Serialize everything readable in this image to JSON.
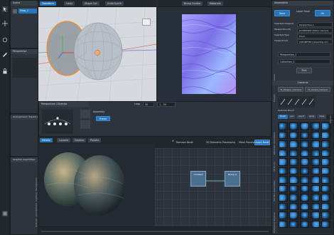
{
  "left_toolbar": {
    "icons": [
      "select-icon",
      "move-icon",
      "rotate-icon",
      "brush-icon",
      "lock-icon",
      "grid-icon"
    ]
  },
  "scene_panel": {
    "title": "Scene",
    "object_name": "Drop_1"
  },
  "perspective_panel": {
    "title": "Perspective"
  },
  "arrangement_panel": {
    "title": "Arrangement / Square Prism"
  },
  "assembly_panel": {
    "title": "Selected Assemblies",
    "tabs": [
      "Settings",
      "Architecture",
      "Lighting",
      "Background",
      "Arrange"
    ]
  },
  "viewport_toolbar": {
    "items": [
      "Transform",
      "Local",
      "Shape Cut",
      "Undo Synth"
    ]
  },
  "texture_toolbar": {
    "items": [
      "Bump Control",
      "Materials"
    ]
  },
  "timeline": {
    "title": "Perspective / Director",
    "field_label": "Assembly",
    "value": "Frame",
    "loop_label": "Loop",
    "loop_value": "30",
    "range_value": "1 - 30"
  },
  "bottom_tabs": [
    "Details",
    "Layouts",
    "Capture",
    "Presets"
  ],
  "node_toolbar": {
    "items": [
      "Remove Node",
      "2D Elements Processing",
      "Mask Processing"
    ],
    "apply_label": "Apply Node"
  },
  "nodes": [
    {
      "label": "Gradient"
    },
    {
      "label": "Bump A"
    }
  ],
  "right_panel": {
    "title": "Assemblies",
    "save_label": "Save",
    "layer_label": "Layer Save",
    "ok_label": "Ok",
    "props": [
      {
        "label": "Selected Viewport",
        "value": "Perspective_1"
      },
      {
        "label": "Perspective (Id)",
        "value": "[CONSTANT] Editor Camera"
      },
      {
        "label": "Selected Type",
        "value": "Fixed"
      },
      {
        "label": "Viewport (Id)",
        "value": "[GEOMETRY] Assembly Ctrl"
      }
    ],
    "side_tabs": [
      "Presets",
      "Presets",
      "Presets"
    ],
    "dropdowns": [
      "Perspective_1",
      "Collection_1"
    ],
    "preset_button": "Find",
    "cameras_title": "Cameras",
    "cameras": [
      "Tk_Perspec_Camera",
      "Tk_Global_Camera"
    ],
    "brush_title": "Selected Brush",
    "brush_tabs": [
      "Brush",
      "pen",
      "pencil",
      "spray",
      "mask",
      "drop"
    ],
    "vertical_tabs": [
      "Materials Assemblies",
      "3D Brush",
      "Wet Mix Assemblies",
      "3D Brushes/FX",
      "Photoshop Brushes"
    ],
    "brush_names": [
      "Rock",
      "Stone",
      "Blob",
      "Crack",
      "Moss",
      "Dust",
      "Sand",
      "Grit"
    ]
  },
  "colors": {
    "accent": "#2a74b8",
    "grid": "#d9dde2",
    "normal_map": "#8a7fe6",
    "node": "#4d6f8f"
  }
}
